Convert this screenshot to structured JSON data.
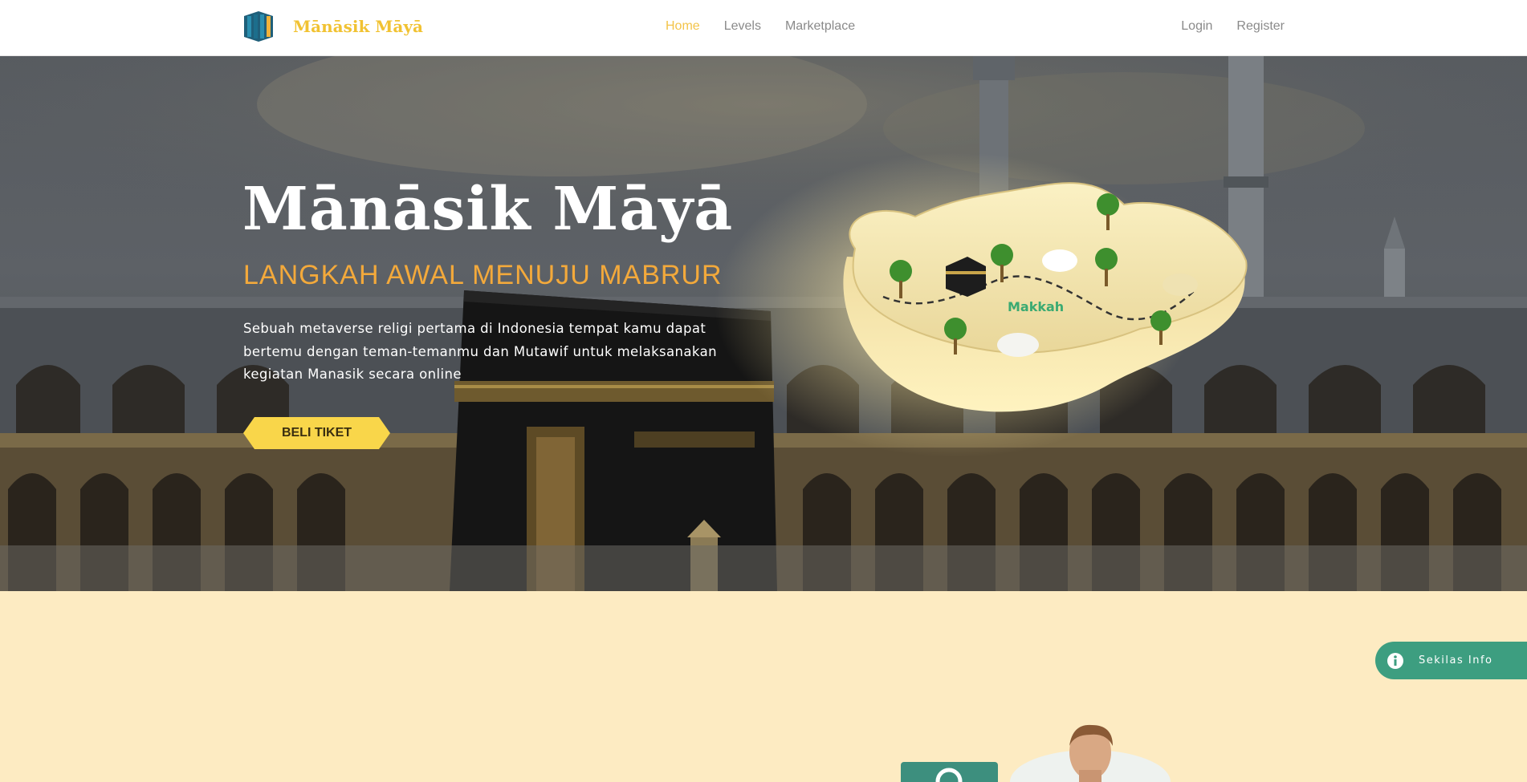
{
  "brand": {
    "name": "Mānāsik Māyā"
  },
  "nav": {
    "center": [
      {
        "label": "Home",
        "active": true
      },
      {
        "label": "Levels",
        "active": false
      },
      {
        "label": "Marketplace",
        "active": false
      }
    ],
    "right": [
      {
        "label": "Login"
      },
      {
        "label": "Register"
      }
    ]
  },
  "hero": {
    "title": "Mānāsik Māyā",
    "subtitle": "LANGKAH AWAL MENUJU MABRUR",
    "description": "Sebuah metaverse religi pertama di Indonesia tempat kamu dapat bertemu dengan teman-temanmu dan Mutawif untuk melaksanakan kegiatan Manasik secara online",
    "cta_label": "BELI TIKET",
    "map_label": "Makkah"
  },
  "info_pill": {
    "label": "Sekilas Info",
    "icon": "info-icon"
  },
  "colors": {
    "brand_gold": "#f1c232",
    "subtitle_orange": "#f3a93b",
    "cta_yellow": "#f9d64a",
    "section_cream": "#fdebc2",
    "accent_green": "#3d9e80",
    "nav_active": "#f3c44a"
  }
}
